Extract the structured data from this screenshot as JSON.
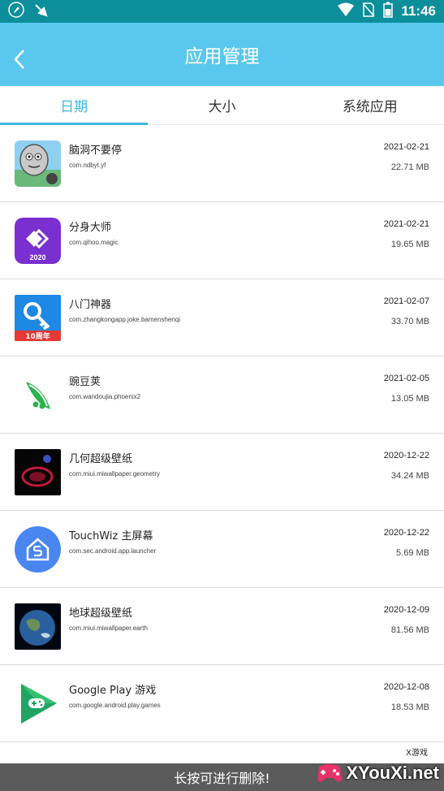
{
  "status_bar": {
    "time": "11:46"
  },
  "header": {
    "title": "应用管理"
  },
  "tabs": [
    {
      "label": "日期"
    },
    {
      "label": "大小"
    },
    {
      "label": "系统应用"
    }
  ],
  "apps": [
    {
      "name": "脑洞不要停",
      "package": "com.ndbyt.yf",
      "date": "2021-02-21",
      "size": "22.71 MB",
      "icon": "cartoon-face-icon"
    },
    {
      "name": "分身大师",
      "package": "com.qihoo.magic",
      "date": "2021-02-21",
      "size": "19.65 MB",
      "icon": "diamond-2020-icon",
      "icon_text": "2020"
    },
    {
      "name": "八门神器",
      "package": "com.zhangkongapp.joke.bamenshenqi",
      "date": "2021-02-07",
      "size": "33.70 MB",
      "icon": "key-icon",
      "icon_text": "10周年"
    },
    {
      "name": "豌豆荚",
      "package": "com.wandoujia.phoenix2",
      "date": "2021-02-05",
      "size": "13.05 MB",
      "icon": "peapod-icon"
    },
    {
      "name": "几何超级壁纸",
      "package": "com.miui.miwallpaper.geometry",
      "date": "2020-12-22",
      "size": "34.24 MB",
      "icon": "geometry-wallpaper-icon"
    },
    {
      "name": "TouchWiz 主屏幕",
      "package": "com.sec.android.app.launcher",
      "date": "2020-12-22",
      "size": "5.69 MB",
      "icon": "launcher-home-icon"
    },
    {
      "name": "地球超级壁纸",
      "package": "com.miui.miwallpaper.earth",
      "date": "2020-12-09",
      "size": "81.56 MB",
      "icon": "earth-icon"
    },
    {
      "name": "Google Play 游戏",
      "package": "com.google.android.play.games",
      "date": "2020-12-08",
      "size": "18.53 MB",
      "icon": "play-games-icon"
    }
  ],
  "toast": {
    "text": "长按可进行删除!"
  },
  "watermark": {
    "text": "XYouXi.net",
    "badge": "X游戏"
  },
  "colors": {
    "status_bar": "#0c8f9b",
    "app_bar": "#5ac8ee",
    "accent": "#3fb8e6"
  }
}
